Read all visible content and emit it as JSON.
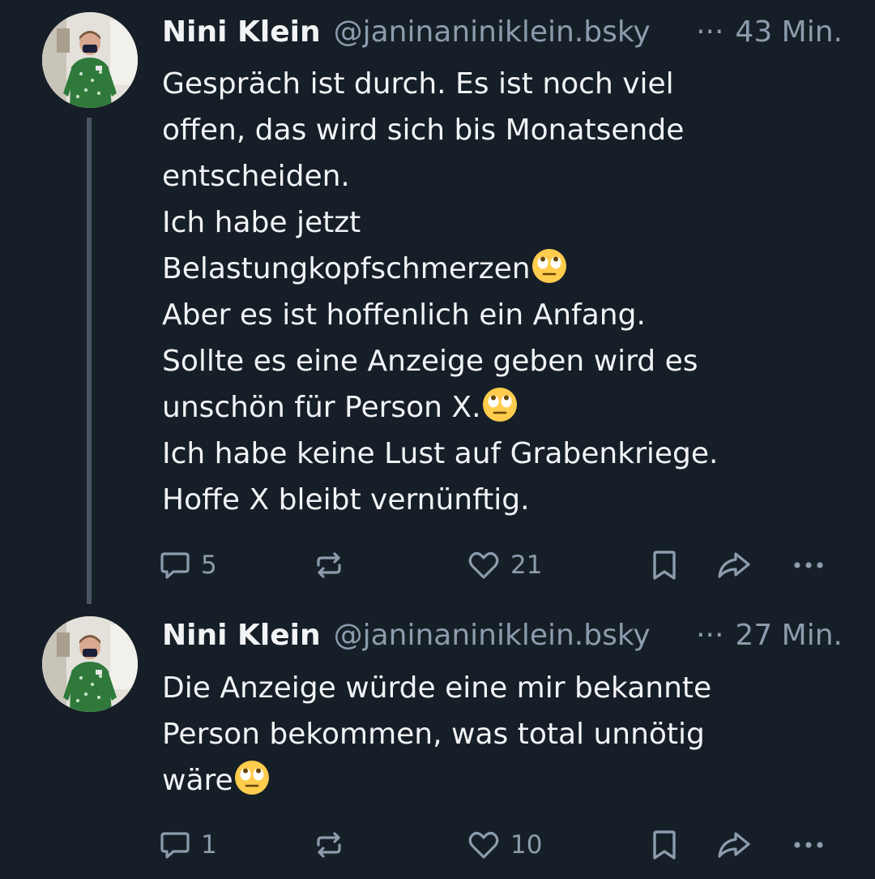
{
  "posts": [
    {
      "author": {
        "display_name": "Nini Klein",
        "handle": "@janinaniniklein.bsky",
        "overflow": "···"
      },
      "time": "43 Min.",
      "text_lines": [
        "Gespräch ist durch. Es ist noch viel",
        "offen, das wird sich bis Monatsende",
        "entscheiden.",
        "Ich habe jetzt",
        "Belastungkopfschmerzen",
        "Aber es ist hoffenlich ein Anfang.",
        "Sollte es eine Anzeige geben wird es",
        "unschön für Person X.",
        "Ich habe keine Lust auf Grabenkriege.",
        "Hoffe X bleibt vernünftig."
      ],
      "actions": {
        "reply_count": "5",
        "repost_count": "",
        "like_count": "21"
      }
    },
    {
      "author": {
        "display_name": "Nini Klein",
        "handle": "@janinaniniklein.bsky",
        "overflow": "···"
      },
      "time": "27 Min.",
      "text_lines": [
        "Die Anzeige würde eine mir bekannte",
        "Person bekommen, was total unnötig",
        "wäre"
      ],
      "actions": {
        "reply_count": "1",
        "repost_count": "",
        "like_count": "10"
      }
    }
  ],
  "icons": {
    "reply": "speech-bubble-icon",
    "repost": "repost-arrows-icon",
    "like": "heart-outline-icon",
    "bookmark": "bookmark-icon",
    "share": "share-arrow-icon",
    "more": "more-horizontal-icon",
    "emoji": "face-with-rolling-eyes-emoji"
  },
  "colors": {
    "background": "#161e27",
    "text_primary": "#f1f3f5",
    "text_secondary": "#8c9cad",
    "thread_line": "#4a5563"
  }
}
